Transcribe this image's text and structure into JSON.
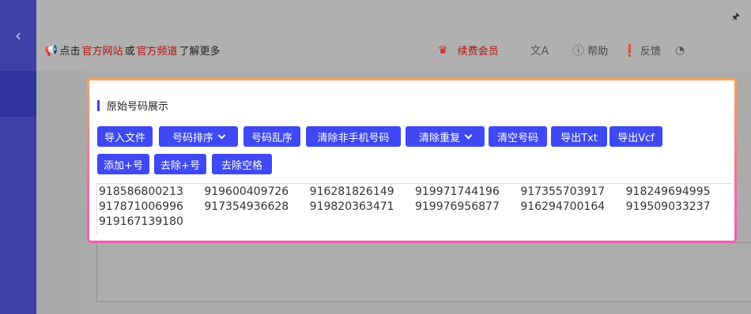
{
  "sidebar": {
    "back_icon": "‹",
    "back_icon_name": "chevron-left-icon"
  },
  "topbar": {
    "pin_icon": "📌",
    "notice": {
      "prefix": "点击",
      "link1": "官方网站",
      "middle": "或",
      "link2": "官方频道",
      "suffix": "了解更多"
    },
    "vip_label": "续费会员",
    "help_label": "帮助",
    "feedback_label": "反馈"
  },
  "card": {
    "title": "原始号码展示",
    "buttons_row1": [
      {
        "label": "导入文件",
        "dropdown": false
      },
      {
        "label": "号码排序",
        "dropdown": true
      },
      {
        "label": "号码乱序",
        "dropdown": false
      },
      {
        "label": "清除非手机号码",
        "dropdown": false
      },
      {
        "label": "清除重复",
        "dropdown": true
      },
      {
        "label": "清空号码",
        "dropdown": false
      },
      {
        "label": "导出Txt",
        "dropdown": false
      },
      {
        "label": "导出Vcf",
        "dropdown": false
      }
    ],
    "buttons_row2": [
      {
        "label": "添加+号",
        "dropdown": false
      },
      {
        "label": "去除+号",
        "dropdown": false
      },
      {
        "label": "去除空格",
        "dropdown": false
      }
    ],
    "numbers": [
      [
        "918586800213",
        "919600409726",
        "916281826149",
        "919971744196",
        "917355703917",
        "918249694995"
      ],
      [
        "917871006996",
        "917354936628",
        "919820363471",
        "919976956877",
        "916294700164",
        "919509033237"
      ],
      [
        "919167139180"
      ]
    ]
  },
  "colors": {
    "sidebar": "#3e41a8",
    "button": "#3e49f3",
    "link": "#b3140c",
    "card_border_top": "#f6a35a",
    "card_border_bottom": "#f35ab9"
  }
}
